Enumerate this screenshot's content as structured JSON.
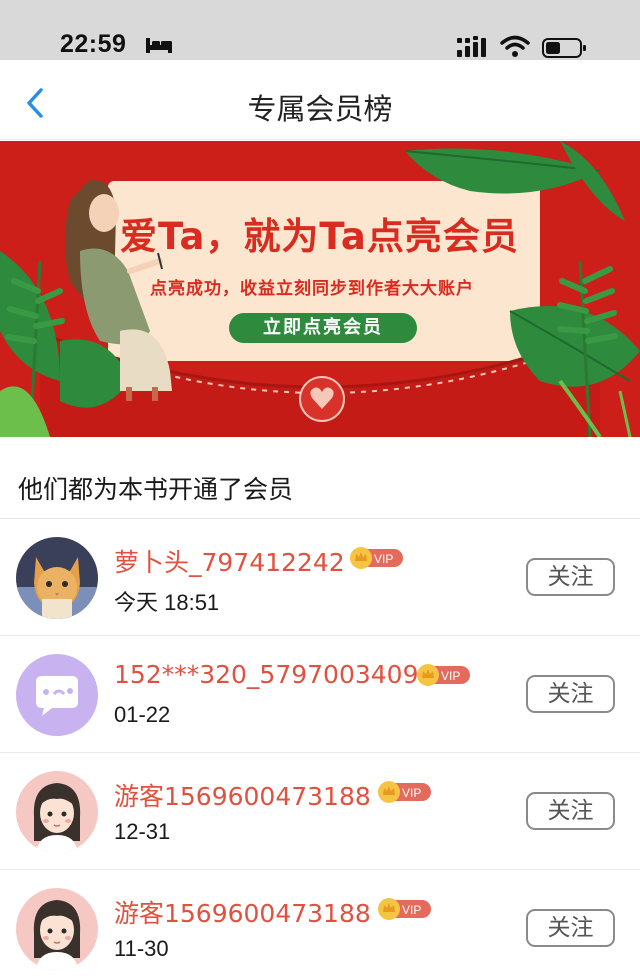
{
  "status_bar": {
    "time": "22:59"
  },
  "nav": {
    "title": "专属会员榜"
  },
  "banner": {
    "headline": "爱Ta，就为Ta点亮会员",
    "subtitle": "点亮成功，收益立刻同步到作者大大账户",
    "cta": "立即点亮会员"
  },
  "section": {
    "title": "他们都为本书开通了会员"
  },
  "members": [
    {
      "name": "萝卜头_797412242",
      "time": "今天 18:51",
      "vip": "VIP",
      "follow": "关注",
      "avatar": "cat-photo"
    },
    {
      "name": "152***320_5797003409",
      "time": "01-22",
      "vip": "VIP",
      "follow": "关注",
      "avatar": "chat-bubble-avatar"
    },
    {
      "name": "游客1569600473188",
      "time": "12-31",
      "vip": "VIP",
      "follow": "关注",
      "avatar": "girl-avatar"
    },
    {
      "name": "游客1569600473188",
      "time": "11-30",
      "vip": "VIP",
      "follow": "关注",
      "avatar": "girl-avatar"
    }
  ],
  "colors": {
    "accent": "#e0513f",
    "banner_red": "#cc1f1a",
    "leaf_green": "#2e8a3c",
    "back_blue": "#2a8ee6"
  }
}
